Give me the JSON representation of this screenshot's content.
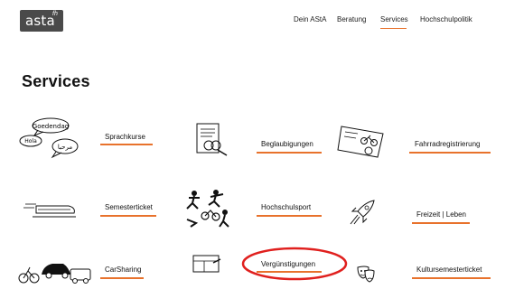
{
  "header": {
    "logo_text": "asta",
    "logo_sup": "fh",
    "nav": [
      "Dein AStA",
      "Beratung",
      "Services",
      "Hochschulpolitik"
    ],
    "active_nav": "Services"
  },
  "page_title": "Services",
  "services": [
    "Sprachkurse",
    "Beglaubigungen",
    "Fahrradregistrierung",
    "Semesterticket",
    "Hochschulsport",
    "Freizeit | Leben",
    "CarSharing",
    "Vergünstigungen",
    "Kultursemesterticket"
  ],
  "illustration_text": {
    "bubble_1": "Goedendag",
    "bubble_2": "Hola",
    "bubble_3": "مرحبا"
  },
  "highlight_color": "#e0201e",
  "accent_color": "#e8722c"
}
